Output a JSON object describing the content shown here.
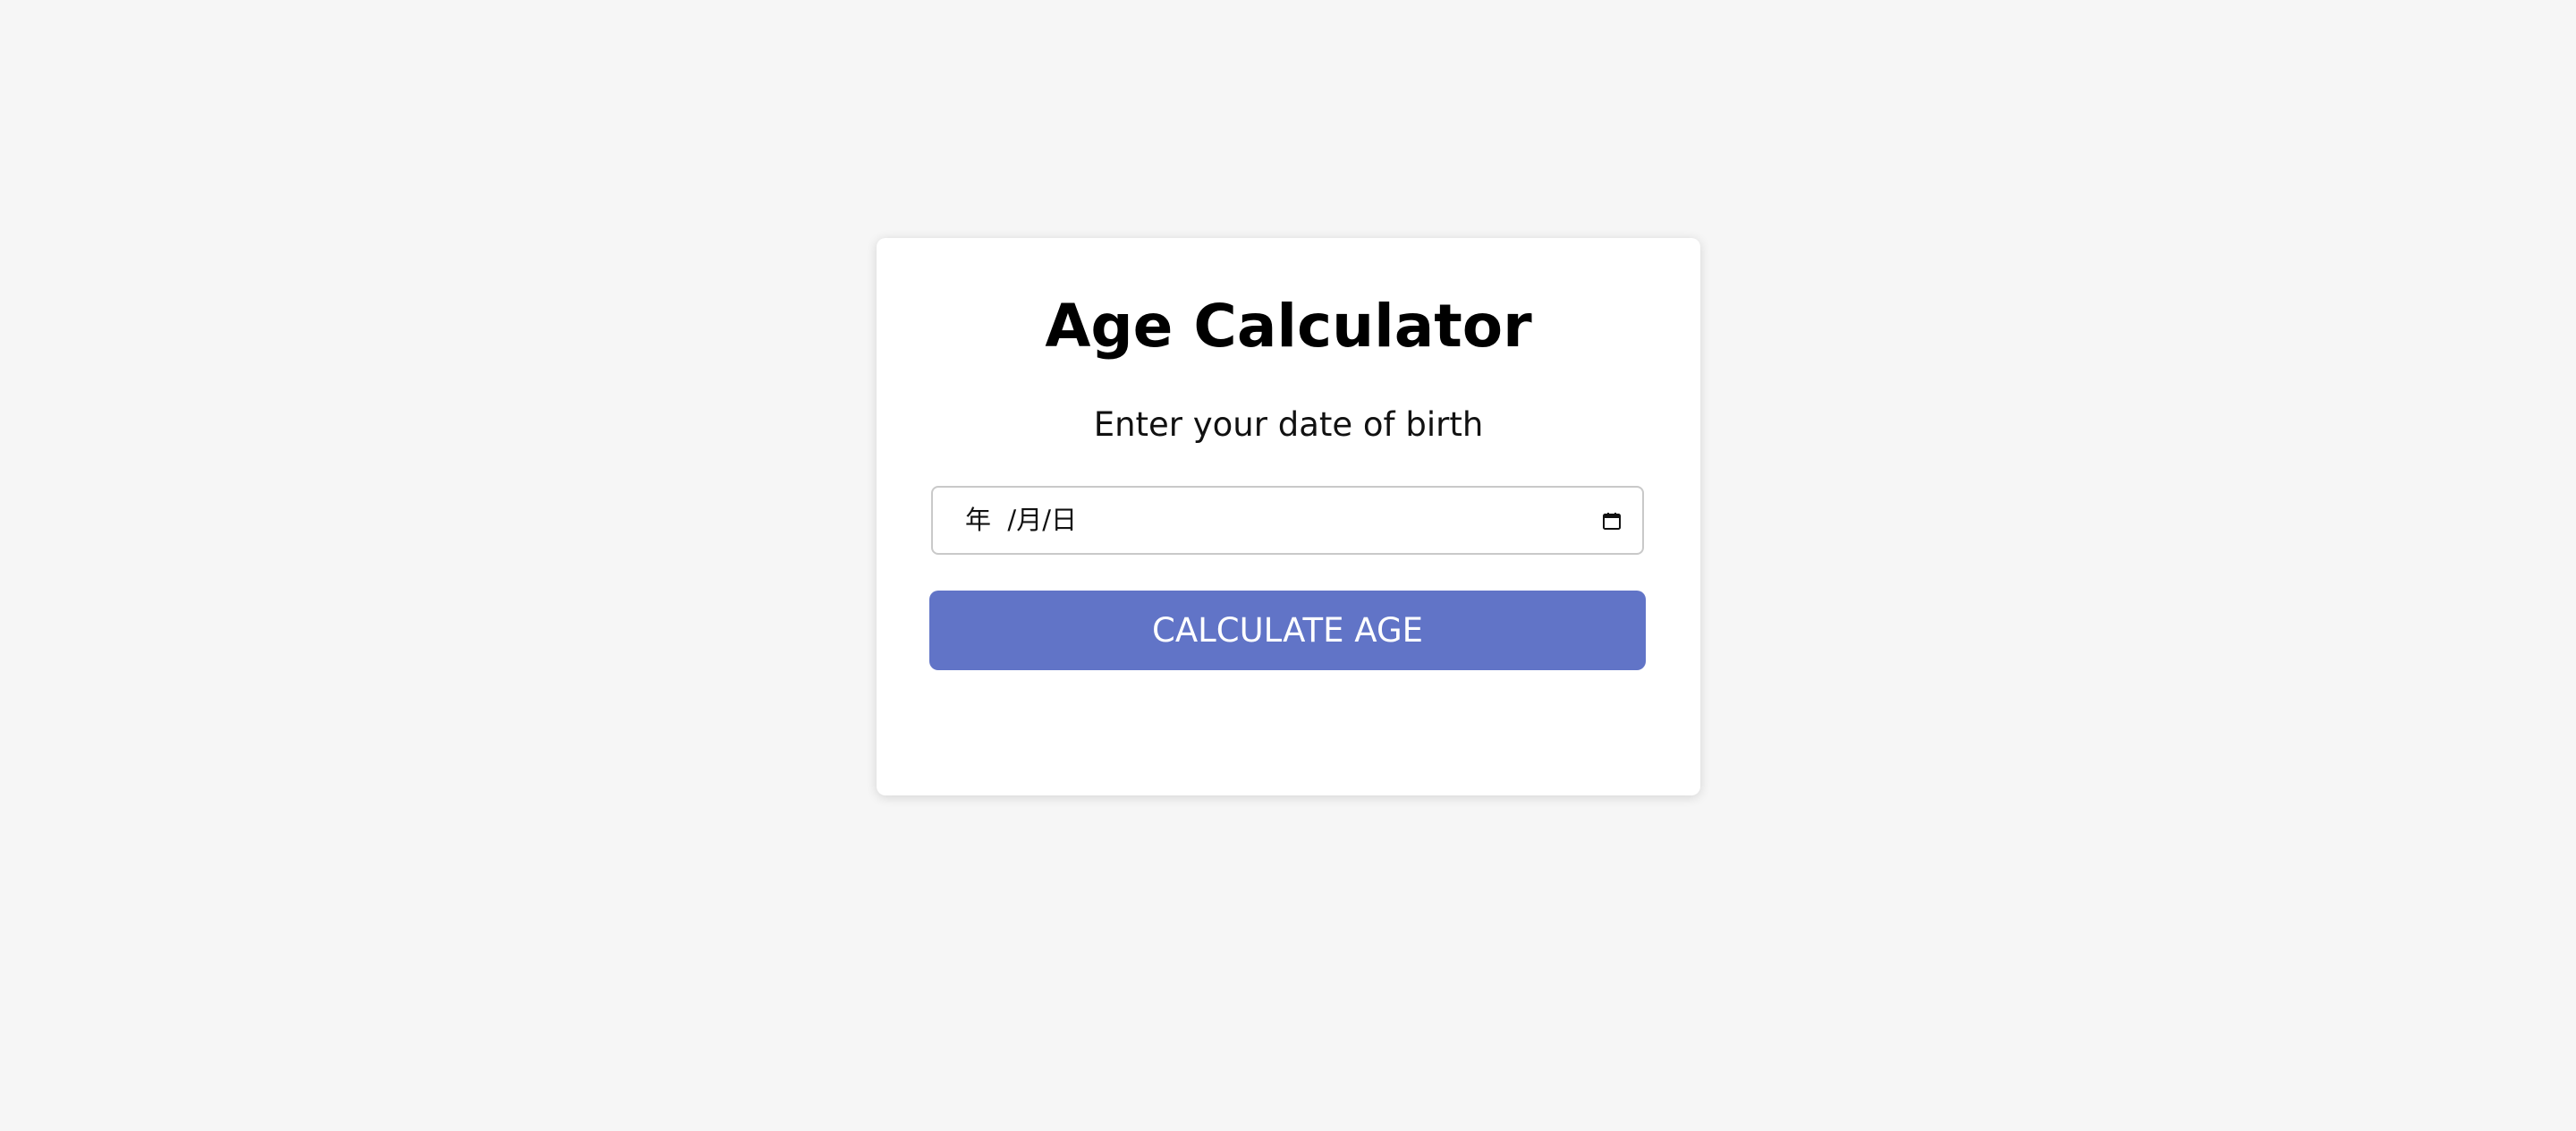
{
  "app": {
    "title": "Age Calculator"
  },
  "form": {
    "label": "Enter your date of birth",
    "date_input_value": "年  /月/日",
    "button_label": "CALCULATE AGE"
  },
  "icons": {
    "calendar": "calendar-icon"
  },
  "colors": {
    "page_background": "#f6f6f6",
    "card_background": "#ffffff",
    "button_background": "#6174c7",
    "button_text": "#ffffff",
    "input_border": "#c9c9c9",
    "text": "#000000"
  }
}
